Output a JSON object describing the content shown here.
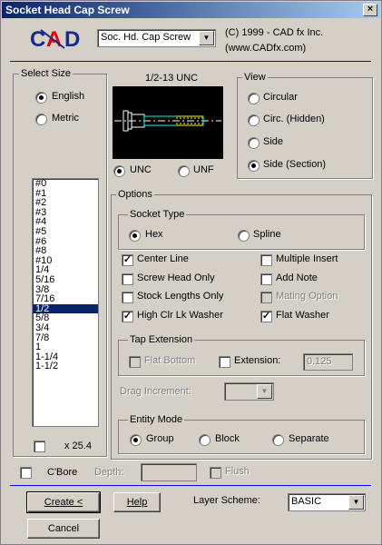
{
  "window": {
    "title": "Socket Head Cap Screw",
    "close_label": "×"
  },
  "header": {
    "logo_text": "CAD",
    "type_select": "Soc. Hd. Cap Screw",
    "copyright": "(C) 1999 - CAD fx Inc.",
    "website": "(www.CADfx.com)"
  },
  "select_size": {
    "label": "Select Size",
    "options": [
      "English",
      "Metric"
    ],
    "selected": "English",
    "sizes": [
      "#0",
      "#1",
      "#2",
      "#3",
      "#4",
      "#5",
      "#6",
      "#8",
      "#10",
      "1/4",
      "5/16",
      "3/8",
      "7/16",
      "1/2",
      "5/8",
      "3/4",
      "7/8",
      "1",
      "1-1/4",
      "1-1/2"
    ],
    "selected_size": "1/2",
    "scale_label": "x 25.4",
    "scale_checked": false
  },
  "preview": {
    "caption": "1/2-13 UNC"
  },
  "thread": {
    "options": [
      "UNC",
      "UNF"
    ],
    "selected": "UNC"
  },
  "view": {
    "label": "View",
    "options": [
      "Circular",
      "Circ. (Hidden)",
      "Side",
      "Side (Section)"
    ],
    "selected": "Side (Section)"
  },
  "options": {
    "label": "Options",
    "socket_type": {
      "label": "Socket Type",
      "options": [
        "Hex",
        "Spline"
      ],
      "selected": "Hex"
    },
    "checks": [
      {
        "label": "Center Line",
        "checked": true,
        "enabled": true
      },
      {
        "label": "Multiple Insert",
        "checked": false,
        "enabled": true
      },
      {
        "label": "Screw Head Only",
        "checked": false,
        "enabled": true
      },
      {
        "label": "Add Note",
        "checked": false,
        "enabled": true
      },
      {
        "label": "Stock Lengths Only",
        "checked": false,
        "enabled": true
      },
      {
        "label": "Mating Option",
        "checked": false,
        "enabled": false
      },
      {
        "label": "High Clr Lk Washer",
        "checked": true,
        "enabled": true
      },
      {
        "label": "Flat Washer",
        "checked": true,
        "enabled": true
      }
    ],
    "tap_extension": {
      "label": "Tap Extension",
      "flat_bottom": "Flat Bottom",
      "extension": "Extension:",
      "extension_value": "0.125"
    },
    "drag_increment": "Drag Increment:",
    "entity_mode": {
      "label": "Entity Mode",
      "options": [
        "Group",
        "Block",
        "Separate"
      ],
      "selected": "Group"
    }
  },
  "cbore": {
    "label": "C'Bore",
    "depth_label": "Depth:",
    "flush_label": "Flush"
  },
  "footer": {
    "create": "Create <",
    "help": "Help",
    "layer_scheme_label": "Layer Scheme:",
    "layer_scheme_value": "BASIC",
    "cancel": "Cancel"
  },
  "colors": {
    "title_start": "#0a246a",
    "title_end": "#a6caf0",
    "separator": "#0000ff",
    "logo_red": "#e00000",
    "logo_blue": "#1a2a8a"
  }
}
